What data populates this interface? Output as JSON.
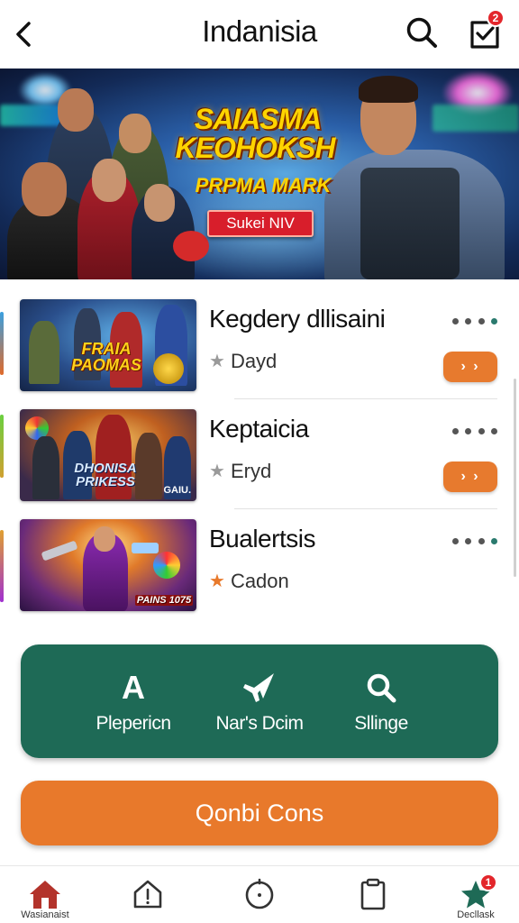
{
  "header": {
    "title": "Indanisia",
    "inbox_badge": "2"
  },
  "banner": {
    "title_line1": "SAIASMA",
    "title_line2": "KEOHOKSH",
    "subtitle": "PRPMA MARK",
    "cta_label": "Sukei NIV"
  },
  "list": {
    "items": [
      {
        "title": "Kegdery dllisaini",
        "meta": "Dayd",
        "thumb_text": "FRAIA PAOMAS",
        "has_action": true,
        "star_color": "#9a9a9a",
        "dots": "teal"
      },
      {
        "title": "Keptaicia",
        "meta": "Eryd",
        "thumb_text": "DHONISA PRIKESS",
        "thumb_tag": "GAIU.",
        "has_action": true,
        "star_color": "#9a9a9a",
        "dots": "gray"
      },
      {
        "title": "Bualertsis",
        "meta": "Cadon",
        "thumb_text": "PAINS 1075",
        "has_action": false,
        "star_color": "#e8792b",
        "dots": "teal"
      }
    ],
    "go_label": "› ›"
  },
  "actions": [
    {
      "label": "Plepericn",
      "icon": "letter-a-icon",
      "glyph": "A"
    },
    {
      "label": "Nar's Dcim",
      "icon": "plane-icon"
    },
    {
      "label": "Sllinge",
      "icon": "search-icon"
    }
  ],
  "primary_button": {
    "label": "Qonbi Cons"
  },
  "bottom_nav": {
    "items": [
      {
        "label": "Wasianaist",
        "icon": "home-icon"
      },
      {
        "label": "",
        "icon": "alert-icon"
      },
      {
        "label": "",
        "icon": "timer-icon"
      },
      {
        "label": "",
        "icon": "clipboard-icon"
      },
      {
        "label": "Decllask",
        "icon": "star-icon",
        "badge": "1"
      }
    ]
  },
  "colors": {
    "accent_green": "#1e6a56",
    "accent_orange": "#e8792b",
    "home_red": "#b3332b",
    "star_green": "#1e6a56",
    "badge_red": "#e3262b"
  }
}
